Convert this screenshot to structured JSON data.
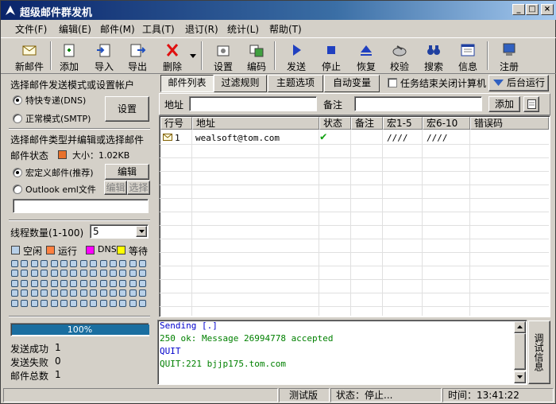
{
  "window": {
    "title": "超级邮件群发机"
  },
  "menu": [
    "文件(F)",
    "编辑(E)",
    "邮件(M)",
    "工具(T)",
    "退订(R)",
    "统计(L)",
    "帮助(T)"
  ],
  "toolbar": {
    "new_mail": "新邮件",
    "add": "添加",
    "import": "导入",
    "export": "导出",
    "delete": "删除",
    "settings": "设置",
    "encode": "编码",
    "send": "发送",
    "stop": "停止",
    "restore": "恢复",
    "verify": "校验",
    "search": "搜索",
    "info": "信息",
    "register": "注册"
  },
  "left": {
    "mode_title": "选择邮件发送模式或设置帐户",
    "mode_fast": "特快专递(DNS)",
    "mode_normal": "正常模式(SMTP)",
    "settings_button": "设置",
    "type_title": "选择邮件类型并编辑或选择邮件",
    "mail_status_label": "邮件状态",
    "mail_size": "大小：1.02KB",
    "macro_mail": "宏定义邮件(推荐)",
    "edit_button": "编辑",
    "outlook_eml": "Outlook eml文件",
    "eml_edit": "编辑",
    "eml_select": "选择",
    "eml_path": "",
    "thread_label": "线程数量(1-100)",
    "thread_value": "5",
    "legend": {
      "idle": "空闲",
      "running": "运行",
      "dns": "DNS",
      "waiting": "等待"
    },
    "progress_text": "100%",
    "progress": 1.0,
    "sent_ok_label": "发送成功",
    "sent_ok": "1",
    "sent_fail_label": "发送失败",
    "sent_fail": "0",
    "total_label": "邮件总数",
    "total": "1"
  },
  "tabs": [
    "邮件列表",
    "过滤规则",
    "主题选项",
    "自动变量"
  ],
  "shutdown_option": "任务结束关闭计算机",
  "background_run": "后台运行",
  "address_bar": {
    "address_label": "地址",
    "address_value": "",
    "note_label": "备注",
    "note_value": "",
    "add_button": "添加"
  },
  "table": {
    "headers": [
      "行号",
      "地址",
      "状态",
      "备注",
      "宏1-5",
      "宏6-10",
      "错误码"
    ],
    "rows": [
      {
        "line": "1",
        "address": "wealsoft@tom.com",
        "status": "✔",
        "note": "",
        "macro15": "////",
        "macro610": "////",
        "error": ""
      }
    ]
  },
  "log": {
    "lines": [
      {
        "text": "Sending [.]",
        "color": "#0000cc"
      },
      {
        "text": "250 ok:  Message 26994778 accepted",
        "color": "#008000"
      },
      {
        "text": "QUIT",
        "color": "#0000cc"
      },
      {
        "text": "QUIT:221 bjjp175.tom.com",
        "color": "#008000"
      }
    ],
    "debug_button": "调试信息"
  },
  "statusbar": {
    "edition": "测试版",
    "state": "状态：停止...",
    "time": "时间：13:41:22"
  },
  "colors": {
    "mail_status": "#e8702a",
    "idle": "#b8d0e8",
    "running": "#ff8040",
    "dns": "#ff00ff",
    "waiting": "#ffff00",
    "progress": "#1a6ea0"
  }
}
